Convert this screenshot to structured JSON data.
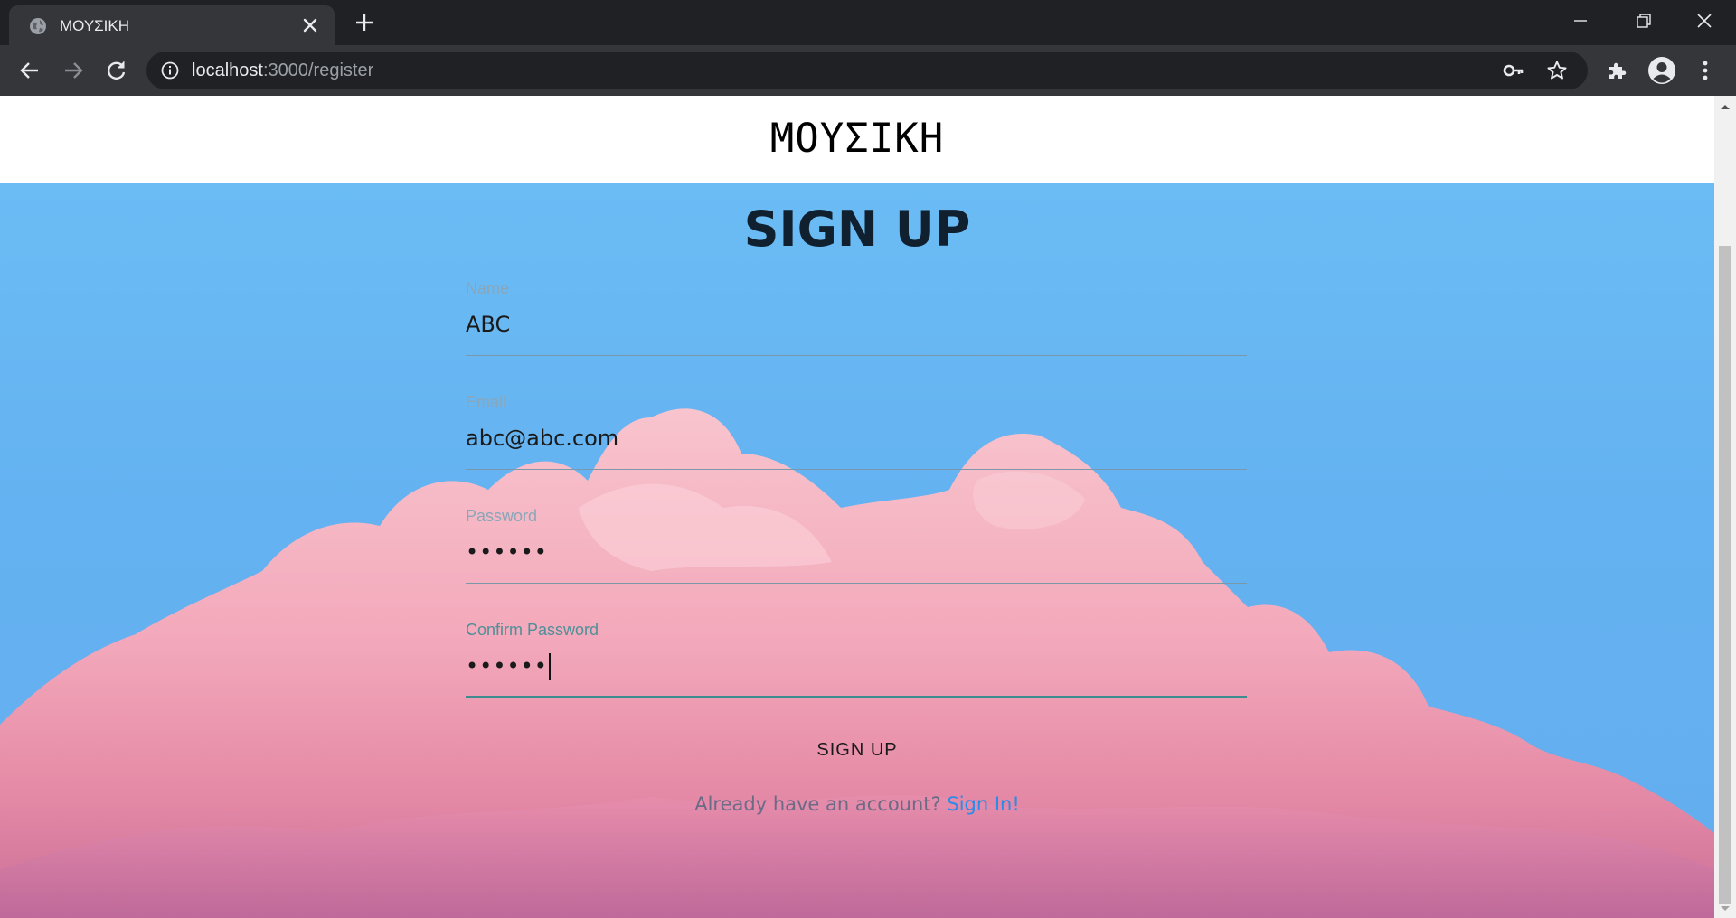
{
  "browser": {
    "tab": {
      "title": "ΜΟΥΣΙΚΗ"
    },
    "address": {
      "host": "localhost",
      "path": ":3000/register"
    }
  },
  "page": {
    "brand": "ΜΟΥΣΙΚΗ",
    "title": "SIGN UP",
    "form": {
      "fields": [
        {
          "label": "Name",
          "value": "ABC",
          "type": "text"
        },
        {
          "label": "Email",
          "value": "abc@abc.com",
          "type": "email"
        },
        {
          "label": "Password",
          "value": "••••••",
          "type": "password"
        },
        {
          "label": "Confirm Password",
          "value": "••••••",
          "type": "password",
          "focused": true
        }
      ],
      "submit_label": "SIGN UP"
    },
    "signin_prompt": "Already have an account?",
    "signin_link": "Sign In!"
  },
  "colors": {
    "sky": "#6bbcf5",
    "cloud": "#f6b8c4",
    "link": "#2b8be6",
    "focus_underline": "#3d8c8f"
  }
}
